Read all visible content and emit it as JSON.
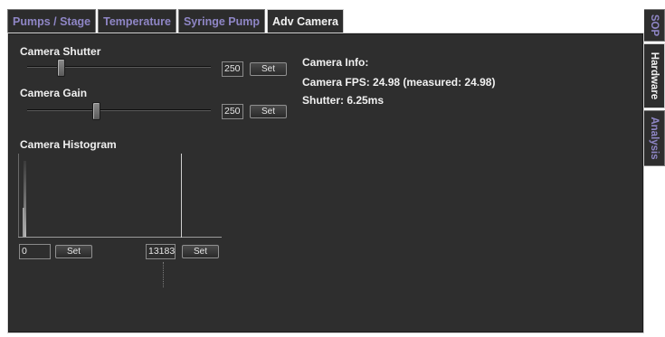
{
  "tabs": [
    {
      "label": "Pumps / Stage"
    },
    {
      "label": "Temperature"
    },
    {
      "label": "Syringe Pump"
    },
    {
      "label": "Adv Camera"
    }
  ],
  "side_tabs": [
    {
      "label": "SOP"
    },
    {
      "label": "Hardware"
    },
    {
      "label": "Analysis"
    }
  ],
  "shutter": {
    "label": "Camera Shutter",
    "value": "250",
    "set_label": "Set",
    "slider_fraction": 0.17
  },
  "gain": {
    "label": "Camera Gain",
    "value": "250",
    "set_label": "Set",
    "slider_fraction": 0.37
  },
  "histogram": {
    "label": "Camera Histogram",
    "min_value": "0",
    "max_value": "13183",
    "min_set_label": "Set",
    "max_set_label": "Set"
  },
  "info": {
    "title": "Camera Info:",
    "fps": "Camera FPS: 24.98 (measured: 24.98)",
    "shutter": "Shutter: 6.25ms"
  },
  "colors": {
    "panel_bg": "#2e2e2e",
    "inactive_tab_text": "#8f86c6",
    "active_tab_text": "#f2f2f2"
  }
}
